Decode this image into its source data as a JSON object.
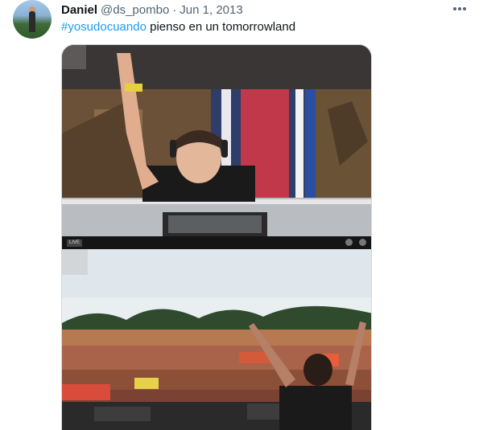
{
  "tweet": {
    "author_name": "Daniel",
    "author_handle": "@ds_pombo",
    "separator": "·",
    "date": "Jun 1, 2013",
    "hashtag": "#yosudocuando",
    "text": " pienso en un tomorrowland",
    "more_icon": "more-icon"
  },
  "media": {
    "player": {
      "live_label": "LIVE"
    }
  },
  "colors": {
    "link": "#1d9bf0",
    "secondary_text": "#536471",
    "primary_text": "#0f1419"
  }
}
